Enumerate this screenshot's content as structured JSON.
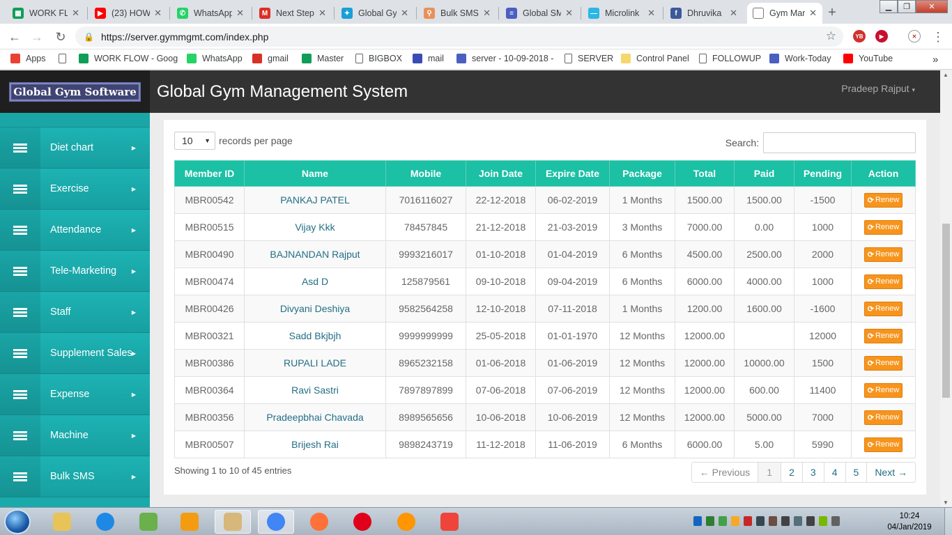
{
  "browser": {
    "tabs": [
      {
        "title": "WORK FLOW",
        "icon": "sheets-icon",
        "color": "#0f9d58",
        "glyph": "▦"
      },
      {
        "title": "(23) HOW",
        "icon": "youtube-icon",
        "color": "#ff0000",
        "glyph": "▶"
      },
      {
        "title": "WhatsApp",
        "icon": "whatsapp-icon",
        "color": "#25d366",
        "glyph": "✆"
      },
      {
        "title": "Next Step",
        "icon": "gmail-icon",
        "color": "#d93025",
        "glyph": "M"
      },
      {
        "title": "Global Gy",
        "icon": "global-icon",
        "color": "#1a9ed8",
        "glyph": "✦"
      },
      {
        "title": "Bulk SMS",
        "icon": "map-pin-icon",
        "color": "#e8915a",
        "glyph": "⚲"
      },
      {
        "title": "Global SM",
        "icon": "docs-icon",
        "color": "#4a5fc1",
        "glyph": "≡"
      },
      {
        "title": "Microlink",
        "icon": "microlink-icon",
        "color": "#2ab7e5",
        "glyph": "—"
      },
      {
        "title": "Dhruvika",
        "icon": "facebook-icon",
        "color": "#3b5998",
        "glyph": "f"
      },
      {
        "title": "Gym Man",
        "icon": "page-icon",
        "color": "#ffffff",
        "glyph": ""
      }
    ],
    "url": "https://server.gymmgmt.com/index.php",
    "bookmarks": [
      {
        "label": "Apps",
        "icon": "apps-grid-icon",
        "color": "#e94235"
      },
      {
        "label": "",
        "icon": "page-icon",
        "color": "#ffffff"
      },
      {
        "label": "WORK FLOW - Goog",
        "icon": "sheets-icon",
        "color": "#0f9d58"
      },
      {
        "label": "WhatsApp",
        "icon": "whatsapp-icon",
        "color": "#25d366"
      },
      {
        "label": "gmail",
        "icon": "gmail-icon",
        "color": "#d93025"
      },
      {
        "label": "Master",
        "icon": "sheets-icon",
        "color": "#0f9d58"
      },
      {
        "label": "BIGBOX",
        "icon": "page-icon",
        "color": "#ffffff"
      },
      {
        "label": "mail",
        "icon": "mail-icon",
        "color": "#3b4bb5"
      },
      {
        "label": "server - 10-09-2018 -",
        "icon": "docs-icon",
        "color": "#4a5fc1"
      },
      {
        "label": "SERVER",
        "icon": "page-icon",
        "color": "#ffffff"
      },
      {
        "label": "Control Panel",
        "icon": "folder-icon",
        "color": "#f5d76e"
      },
      {
        "label": "FOLLOWUP",
        "icon": "page-icon",
        "color": "#ffffff"
      },
      {
        "label": "Work-Today",
        "icon": "docs-icon",
        "color": "#4a5fc1"
      },
      {
        "label": "YouTube",
        "icon": "youtube-icon",
        "color": "#ff0000"
      }
    ],
    "more": "»"
  },
  "app": {
    "logo": "Global Gym Software",
    "title": "Global Gym Management System",
    "user": "Pradeep Rajput",
    "accent": "#1cc0a4",
    "sidebar_color": "#1aaaab",
    "renew_color": "#f7941d"
  },
  "sidebar": {
    "items": [
      {
        "label": "Diet chart"
      },
      {
        "label": "Exercise"
      },
      {
        "label": "Attendance"
      },
      {
        "label": "Tele-Marketing"
      },
      {
        "label": "Staff"
      },
      {
        "label": "Supplement Sales"
      },
      {
        "label": "Expense"
      },
      {
        "label": "Machine"
      },
      {
        "label": "Bulk SMS"
      }
    ]
  },
  "table": {
    "length_value": "10",
    "length_label": "records per page",
    "search_label": "Search:",
    "search_value": "",
    "columns": [
      "Member ID",
      "Name",
      "Mobile",
      "Join Date",
      "Expire Date",
      "Package",
      "Total",
      "Paid",
      "Pending",
      "Action"
    ],
    "rows": [
      [
        "MBR00542",
        "PANKAJ PATEL",
        "7016116027",
        "22-12-2018",
        "06-02-2019",
        "1 Months",
        "1500.00",
        "1500.00",
        "-1500"
      ],
      [
        "MBR00515",
        "Vijay Kkk",
        "78457845",
        "21-12-2018",
        "21-03-2019",
        "3 Months",
        "7000.00",
        "0.00",
        "1000"
      ],
      [
        "MBR00490",
        "BAJNANDAN Rajput",
        "9993216017",
        "01-10-2018",
        "01-04-2019",
        "6 Months",
        "4500.00",
        "2500.00",
        "2000"
      ],
      [
        "MBR00474",
        "Asd D",
        "125879561",
        "09-10-2018",
        "09-04-2019",
        "6 Months",
        "6000.00",
        "4000.00",
        "1000"
      ],
      [
        "MBR00426",
        "Divyani Deshiya",
        "9582564258",
        "12-10-2018",
        "07-11-2018",
        "1 Months",
        "1200.00",
        "1600.00",
        "-1600"
      ],
      [
        "MBR00321",
        "Sadd Bkjbjh",
        "9999999999",
        "25-05-2018",
        "01-01-1970",
        "12 Months",
        "12000.00",
        "",
        "12000"
      ],
      [
        "MBR00386",
        "RUPALI LADE",
        "8965232158",
        "01-06-2018",
        "01-06-2019",
        "12 Months",
        "12000.00",
        "10000.00",
        "1500"
      ],
      [
        "MBR00364",
        "Ravi Sastri",
        "7897897899",
        "07-06-2018",
        "07-06-2019",
        "12 Months",
        "12000.00",
        "600.00",
        "11400"
      ],
      [
        "MBR00356",
        "Pradeepbhai Chavada",
        "8989565656",
        "10-06-2018",
        "10-06-2019",
        "12 Months",
        "12000.00",
        "5000.00",
        "7000"
      ],
      [
        "MBR00507",
        "Brijesh Rai",
        "9898243719",
        "11-12-2018",
        "11-06-2019",
        "6 Months",
        "6000.00",
        "5.00",
        "5990"
      ]
    ],
    "renew_label": "Renew",
    "info": "Showing 1 to 10 of 45 entries",
    "pager": [
      "← Previous",
      "1",
      "2",
      "3",
      "4",
      "5",
      "Next →"
    ],
    "current_page": "1"
  },
  "taskbar": {
    "apps": [
      {
        "icon": "file-explorer-icon",
        "color": "#e8c35a"
      },
      {
        "icon": "internet-explorer-icon",
        "color": "#1e88e5"
      },
      {
        "icon": "corel-draw-icon",
        "color": "#6ab04c"
      },
      {
        "icon": "media-player-icon",
        "color": "#f39c12"
      },
      {
        "icon": "paint-icon",
        "color": "#d7b87a"
      },
      {
        "icon": "chrome-icon",
        "color": "#4285f4"
      },
      {
        "icon": "firefox-dev-icon",
        "color": "#ff7139"
      },
      {
        "icon": "opera-icon",
        "color": "#e0001b"
      },
      {
        "icon": "firefox-icon",
        "color": "#ff9500"
      },
      {
        "icon": "anydesk-icon",
        "color": "#ef443b"
      }
    ],
    "time": "10:24",
    "date": "04/Jan/2019"
  }
}
